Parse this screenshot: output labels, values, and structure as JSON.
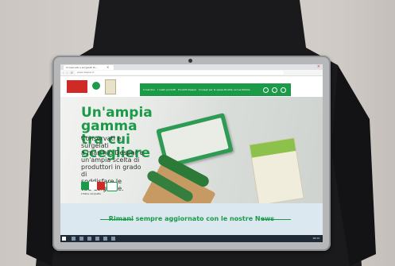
{
  "browser": {
    "tab_title": "Conservati e surgelati Dr...",
    "close_symbol": "×",
    "address": "www.despar.it",
    "nav_symbols": "‹ › ⟳"
  },
  "site": {
    "menu": [
      "Il marchio",
      "I nostri prodotti",
      "Prodotti Despar",
      "Consigli per la spesa",
      "Ricette",
      "Le tue Notizie"
    ]
  },
  "hero": {
    "title": "Un'ampia gamma\ntra cui scegliere",
    "body": "Conservati e surgelati\na marchio Despar e\nun'ampia scelta di\nproduttori in grado di\nsoddisfare le\ntue esigenze.",
    "flag_colors": [
      "#1b9a48",
      "#ffffff",
      "#d02a26"
    ],
    "small_label": "L'Italia nel piatto"
  },
  "news": {
    "text": "Rimani sempre aggiornato con le nostre News"
  },
  "taskbar": {
    "clock": "18:12"
  },
  "colors": {
    "brand_green": "#1b9a48",
    "brand_red": "#d02a26"
  }
}
